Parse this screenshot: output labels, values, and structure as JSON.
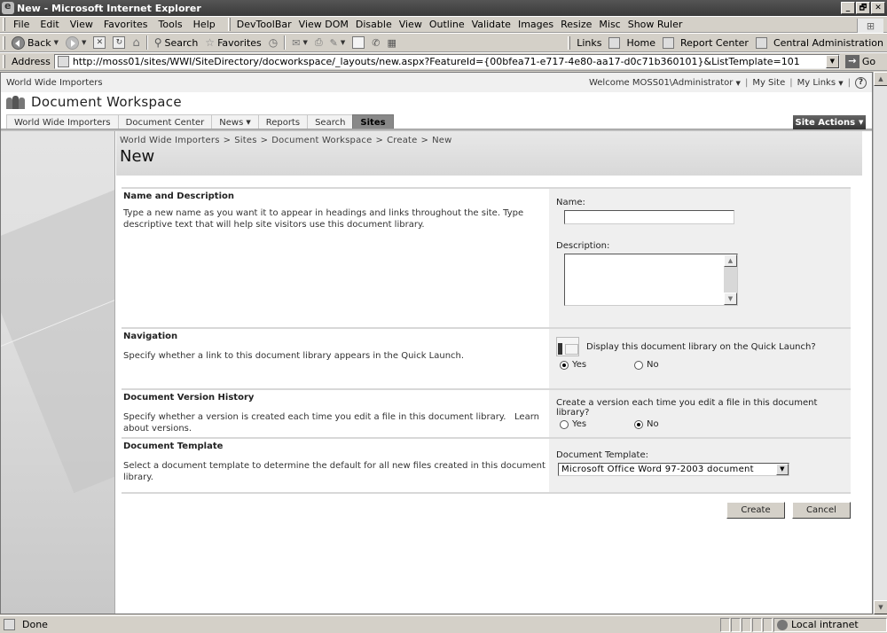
{
  "window": {
    "title": "New - Microsoft Internet Explorer",
    "controls": [
      "_",
      "🗗",
      "✕"
    ]
  },
  "menubar": {
    "items": [
      "File",
      "Edit",
      "View",
      "Favorites",
      "Tools",
      "Help"
    ],
    "devtoolbar": [
      "DevToolBar",
      "View DOM",
      "Disable",
      "View",
      "Outline",
      "Validate",
      "Images",
      "Resize",
      "Misc",
      "Show Ruler"
    ]
  },
  "toolbar": {
    "back": "Back",
    "search": "Search",
    "favorites": "Favorites",
    "links_label": "Links",
    "links": [
      "Home",
      "Report Center",
      "Central Administration"
    ]
  },
  "address": {
    "label": "Address",
    "url": "http://moss01/sites/WWI/SiteDirectory/docworkspace/_layouts/new.aspx?FeatureId={00bfea71-e717-4e80-aa17-d0c71b360101}&ListTemplate=101",
    "go": "Go"
  },
  "sharepoint": {
    "site_name": "World Wide Importers",
    "welcome": "Welcome MOSS01\\Administrator",
    "my_site": "My Site",
    "my_links": "My Links",
    "help": "?",
    "workspace_title": "Document Workspace",
    "tabs": [
      {
        "label": "World Wide Importers",
        "active": false,
        "dropdown": false
      },
      {
        "label": "Document Center",
        "active": false,
        "dropdown": false
      },
      {
        "label": "News",
        "active": false,
        "dropdown": true
      },
      {
        "label": "Reports",
        "active": false,
        "dropdown": false
      },
      {
        "label": "Search",
        "active": false,
        "dropdown": false
      },
      {
        "label": "Sites",
        "active": true,
        "dropdown": false
      }
    ],
    "site_actions": "Site Actions",
    "breadcrumb": [
      "World Wide Importers",
      "Sites",
      "Document Workspace",
      "Create",
      "New"
    ],
    "breadcrumb_sep": ">",
    "page_title": "New"
  },
  "form": {
    "name_desc": {
      "heading": "Name and Description",
      "text": "Type a new name as you want it to appear in headings and links throughout the site. Type descriptive text that will help site visitors use this document library.",
      "name_label": "Name:",
      "name_value": "",
      "description_label": "Description:",
      "description_value": ""
    },
    "navigation": {
      "heading": "Navigation",
      "text": "Specify whether a link to this document library appears in the Quick Launch.",
      "question": "Display this document library on the Quick Launch?",
      "options": [
        "Yes",
        "No"
      ],
      "selected": "Yes"
    },
    "versioning": {
      "heading": "Document Version History",
      "text": "Specify whether a version is created each time you edit a file in this document library.",
      "link": "Learn about versions.",
      "question": "Create a version each time you edit a file in this document library?",
      "options": [
        "Yes",
        "No"
      ],
      "selected": "No"
    },
    "template": {
      "heading": "Document Template",
      "text": "Select a document template to determine the default for all new files created in this document library.",
      "label": "Document Template:",
      "selected": "Microsoft Office Word 97-2003 document"
    },
    "create": "Create",
    "cancel": "Cancel"
  },
  "status": {
    "text": "Done",
    "zone": "Local intranet"
  }
}
